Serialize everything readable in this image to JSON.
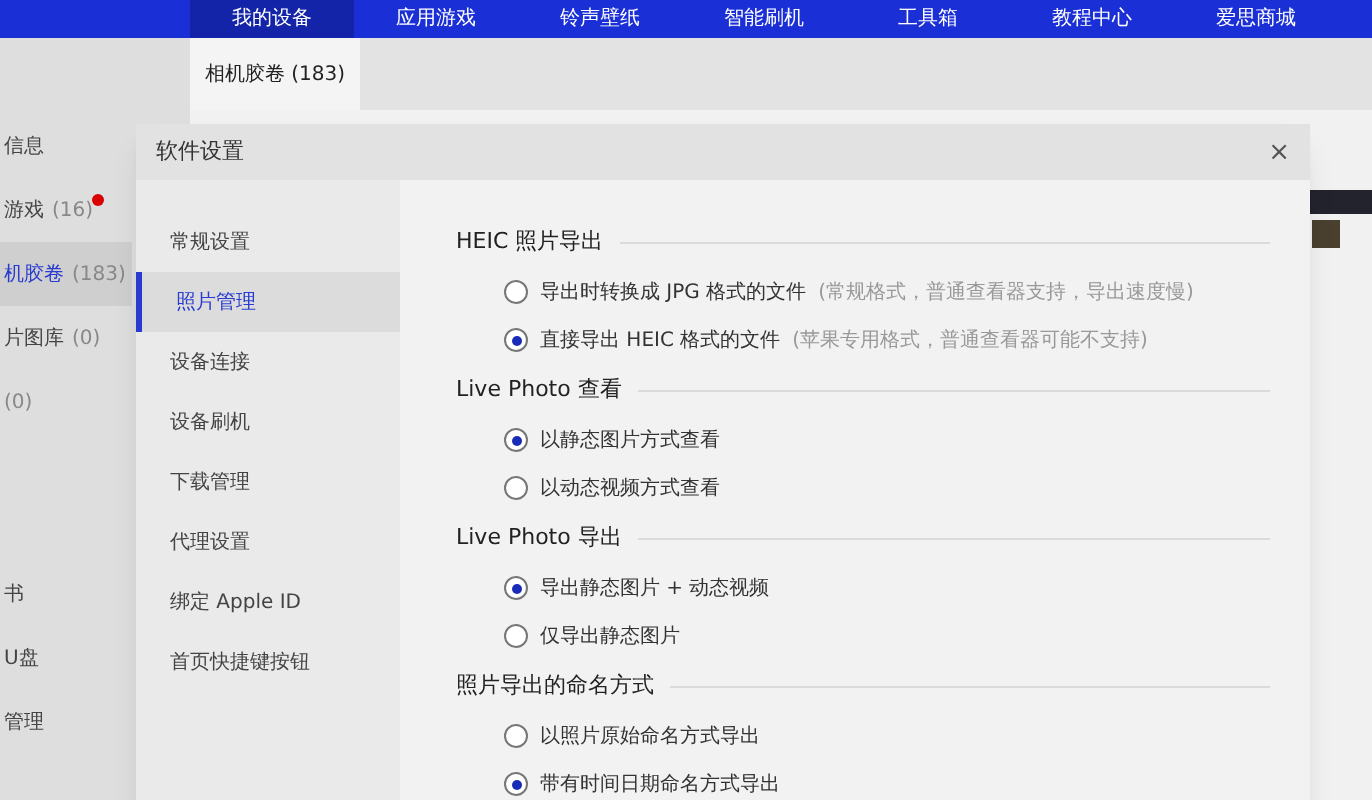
{
  "top_nav": [
    {
      "label": "我的设备",
      "selected": true
    },
    {
      "label": "应用游戏",
      "selected": false
    },
    {
      "label": "铃声壁纸",
      "selected": false
    },
    {
      "label": "智能刷机",
      "selected": false
    },
    {
      "label": "工具箱",
      "selected": false
    },
    {
      "label": "教程中心",
      "selected": false
    },
    {
      "label": "爱思商城",
      "selected": false
    }
  ],
  "tab": {
    "label": "相机胶卷 (183)"
  },
  "sidebar": {
    "items": [
      {
        "label": "信息",
        "selected": false,
        "badge": false
      },
      {
        "label": "游戏",
        "count": "(16)",
        "selected": false,
        "badge": true
      },
      {
        "label": "机胶卷",
        "count": "(183)",
        "selected": true,
        "badge": false
      },
      {
        "label": "片图库",
        "count": "(0)",
        "selected": false,
        "badge": false
      },
      {
        "count": "(0)",
        "selected": false,
        "badge": false
      },
      {
        "label": "书",
        "selected": false,
        "badge": false,
        "gap": true
      },
      {
        "label": "U盘",
        "selected": false,
        "badge": false
      },
      {
        "label": "管理",
        "selected": false,
        "badge": false
      }
    ]
  },
  "dialog": {
    "title": "软件设置",
    "close": "×",
    "nav": [
      {
        "label": "常规设置",
        "selected": false
      },
      {
        "label": "照片管理",
        "selected": true
      },
      {
        "label": "设备连接",
        "selected": false
      },
      {
        "label": "设备刷机",
        "selected": false
      },
      {
        "label": "下载管理",
        "selected": false
      },
      {
        "label": "代理设置",
        "selected": false
      },
      {
        "label": "绑定 Apple ID",
        "selected": false
      },
      {
        "label": "首页快捷键按钮",
        "selected": false
      }
    ],
    "sections": [
      {
        "title": "HEIC 照片导出",
        "options": [
          {
            "label": "导出时转换成 JPG 格式的文件",
            "note": "(常规格式，普通查看器支持，导出速度慢)",
            "selected": false
          },
          {
            "label": "直接导出 HEIC 格式的文件",
            "note": "(苹果专用格式，普通查看器可能不支持)",
            "selected": true
          }
        ]
      },
      {
        "title": "Live Photo 查看",
        "options": [
          {
            "label": "以静态图片方式查看",
            "selected": true
          },
          {
            "label": "以动态视频方式查看",
            "selected": false
          }
        ]
      },
      {
        "title": "Live Photo 导出",
        "options": [
          {
            "label": "导出静态图片 + 动态视频",
            "selected": true
          },
          {
            "label": "仅导出静态图片",
            "selected": false
          }
        ]
      },
      {
        "title": "照片导出的命名方式",
        "options": [
          {
            "label": "以照片原始命名方式导出",
            "selected": false
          },
          {
            "label": "带有时间日期命名方式导出",
            "selected": true
          }
        ]
      }
    ]
  }
}
